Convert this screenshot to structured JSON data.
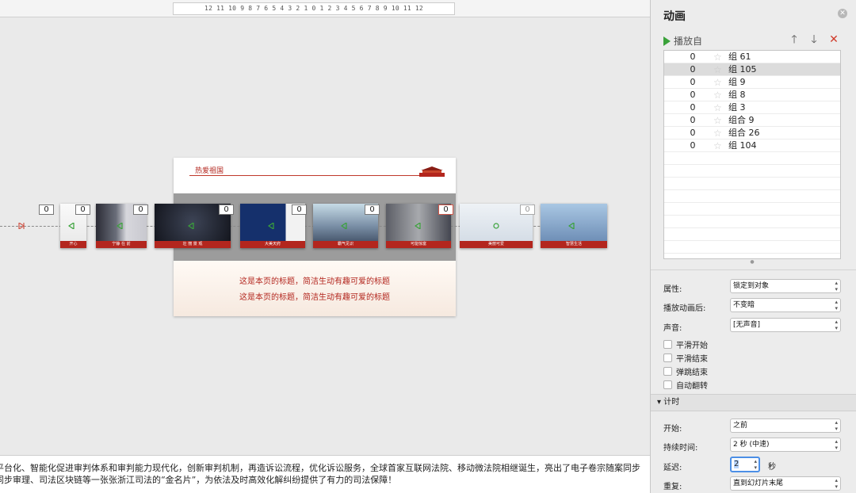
{
  "canvas": {
    "ruler_text": "12 11 10 9 8 7 6 5 4 3 2 1 0 1 2 3 4 5 6 7 8 9 10 11 12",
    "slide": {
      "title": "热爱祖国",
      "subtitle1": "这是本页的标题，简洁生动有趣可爱的标题",
      "subtitle2": "这是本页的标题，简洁生动有趣可爱的标题"
    },
    "thumbnails": [
      {
        "label": "开心",
        "badge": "0"
      },
      {
        "label": "宁静 在  前",
        "badge": "0"
      },
      {
        "label": "壮 丽 景 观",
        "badge": "0"
      },
      {
        "label": "大美天府",
        "badge": "0"
      },
      {
        "label": "霸气见识",
        "badge": "0"
      },
      {
        "label": "可能惊富",
        "badge": "0"
      },
      {
        "label": "美丽可爱",
        "badge": "0"
      },
      {
        "label": "智慧生活",
        "badge": ""
      }
    ],
    "notes": [
      "平台化、智能化促进审判体系和审判能力现代化，创新审判机制，再造诉讼流程，优化诉讼服务，全球首家互联网法院、移动微法院相继诞生，亮出了电子卷宗随案同步",
      "同步审理、司法区块链等一张张浙江司法的“金名片”，为依法及时高效化解纠纷提供了有力的司法保障！"
    ]
  },
  "panel": {
    "title": "动画",
    "play_label": "播放自",
    "animations": [
      {
        "delay": "0",
        "name": "组 61",
        "selected": false
      },
      {
        "delay": "0",
        "name": "组 105",
        "selected": true
      },
      {
        "delay": "0",
        "name": "组 9",
        "selected": false
      },
      {
        "delay": "0",
        "name": "组 8",
        "selected": false
      },
      {
        "delay": "0",
        "name": "组 3",
        "selected": false
      },
      {
        "delay": "0",
        "name": "组合 9",
        "selected": false
      },
      {
        "delay": "0",
        "name": "组合 26",
        "selected": false
      },
      {
        "delay": "0",
        "name": "组 104",
        "selected": false
      }
    ],
    "properties": {
      "attr_label": "属性:",
      "attr_value": "锁定到对象",
      "after_label": "播放动画后:",
      "after_value": "不变暗",
      "sound_label": "声音:",
      "sound_value": "[无声音]"
    },
    "checkboxes": [
      "平滑开始",
      "平滑结束",
      "弹跳结束",
      "自动翻转"
    ],
    "timing": {
      "section_label": "计时",
      "start_label": "开始:",
      "start_value": "之前",
      "duration_label": "持续时间:",
      "duration_value": "2 秒 (中速)",
      "delay_label": "延迟:",
      "delay_value": "2",
      "delay_unit": "秒",
      "repeat_label": "重复:",
      "repeat_value": "直到幻灯片末尾"
    },
    "colors": {
      "accent_red": "#b3261e",
      "play_green": "#3aa23a",
      "focus_blue": "#4c8fe6"
    }
  }
}
